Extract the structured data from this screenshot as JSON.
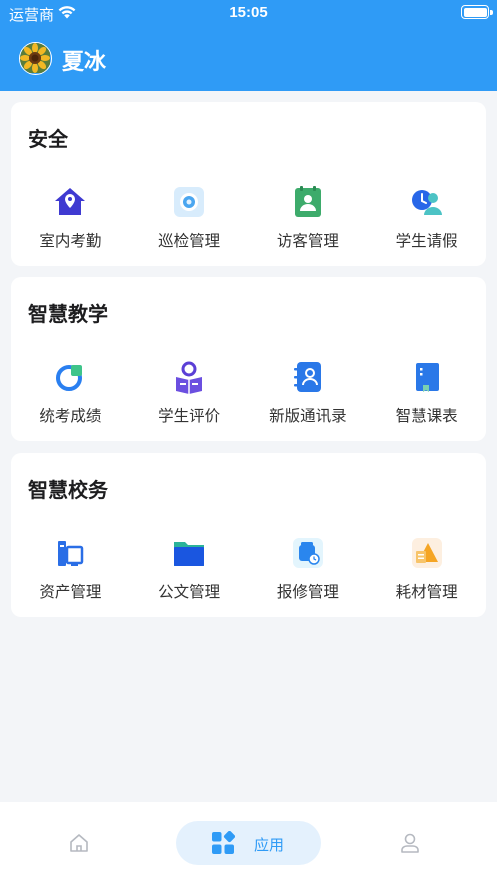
{
  "status_bar": {
    "carrier": "运营商",
    "time": "15:05",
    "battery_level": 1.0
  },
  "header": {
    "user_name": "夏冰"
  },
  "sections": [
    {
      "title": "安全",
      "items": [
        {
          "label": "室内考勤",
          "icon": "home-location-icon"
        },
        {
          "label": "巡检管理",
          "icon": "inspection-camera-icon"
        },
        {
          "label": "访客管理",
          "icon": "visitor-badge-icon"
        },
        {
          "label": "学生请假",
          "icon": "student-leave-icon"
        }
      ]
    },
    {
      "title": "智慧教学",
      "items": [
        {
          "label": "统考成绩",
          "icon": "pie-chart-icon"
        },
        {
          "label": "学生评价",
          "icon": "student-reading-icon"
        },
        {
          "label": "新版通讯录",
          "icon": "contact-book-icon"
        },
        {
          "label": "智慧课表",
          "icon": "schedule-book-icon"
        }
      ]
    },
    {
      "title": "智慧校务",
      "items": [
        {
          "label": "资产管理",
          "icon": "asset-computer-icon"
        },
        {
          "label": "公文管理",
          "icon": "document-folder-icon"
        },
        {
          "label": "报修管理",
          "icon": "repair-icon"
        },
        {
          "label": "耗材管理",
          "icon": "supplies-icon"
        }
      ]
    }
  ],
  "tabbar": {
    "items": [
      {
        "label": "",
        "icon": "home-icon",
        "active": false
      },
      {
        "label": "应用",
        "icon": "apps-icon",
        "active": true
      },
      {
        "label": "",
        "icon": "user-icon",
        "active": false
      }
    ],
    "accent": "#2f9bf6"
  },
  "colors": {
    "header_bg": "#2f9bf6",
    "page_bg": "#f3f5f8",
    "card_bg": "#ffffff"
  }
}
